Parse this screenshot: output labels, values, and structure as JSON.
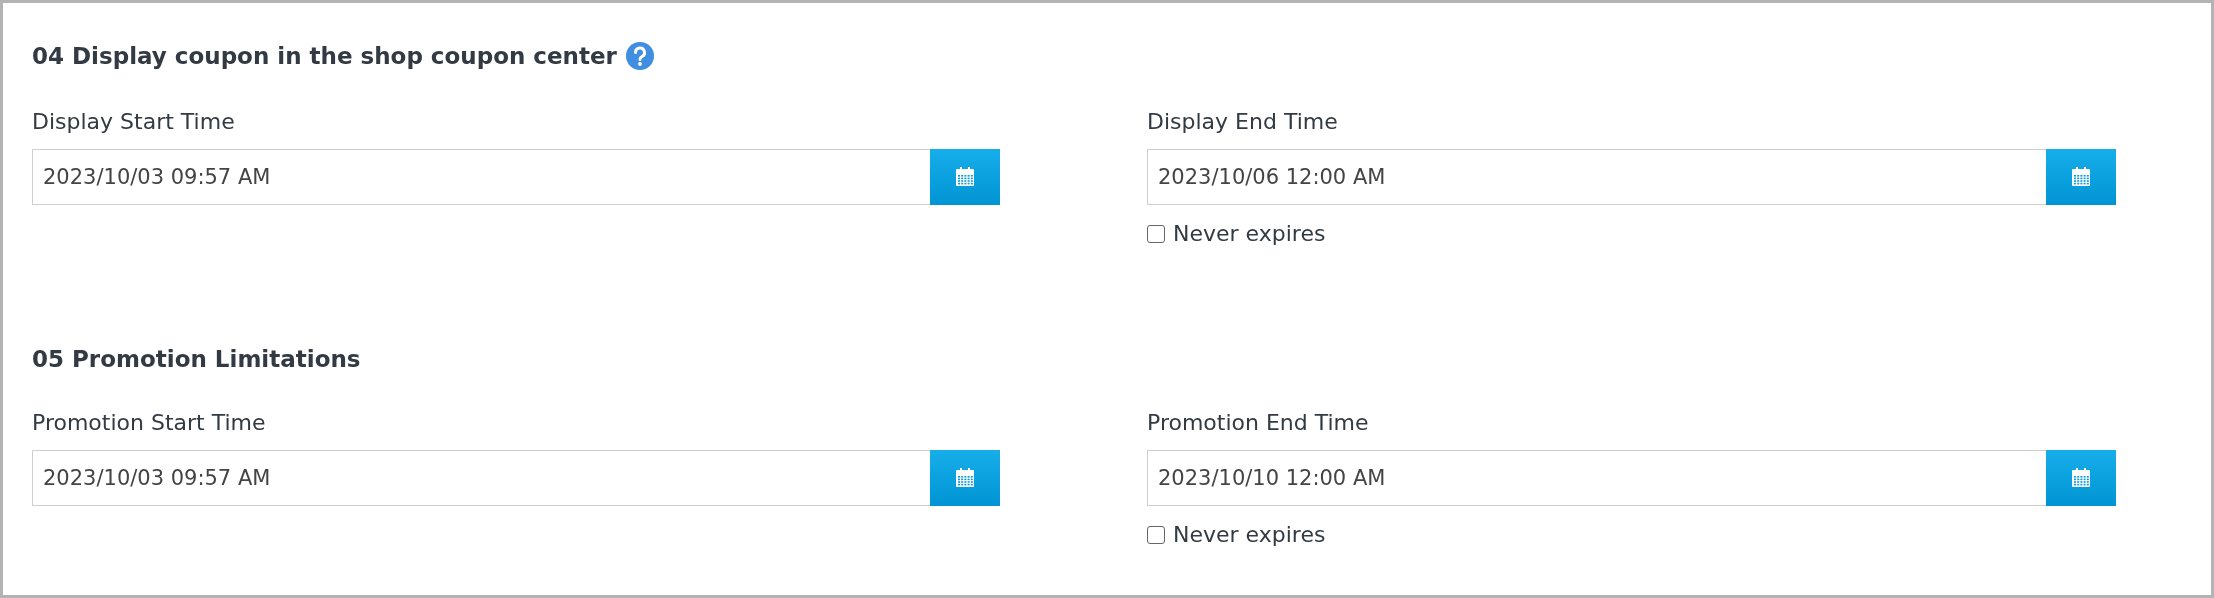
{
  "sections": [
    {
      "title": "04 Display coupon in the shop coupon center",
      "help_icon": true,
      "fields": [
        {
          "label": "Display Start Time",
          "value": "2023/10/03 09:57 AM"
        },
        {
          "label": "Display End Time",
          "value": "2023/10/06 12:00 AM",
          "never_expires": {
            "label": "Never expires",
            "checked": false
          }
        }
      ]
    },
    {
      "title": "05 Promotion Limitations",
      "help_icon": false,
      "fields": [
        {
          "label": "Promotion Start Time",
          "value": "2023/10/03 09:57 AM"
        },
        {
          "label": "Promotion End Time",
          "value": "2023/10/10 12:00 AM",
          "never_expires": {
            "label": "Never expires",
            "checked": false
          }
        }
      ]
    }
  ]
}
